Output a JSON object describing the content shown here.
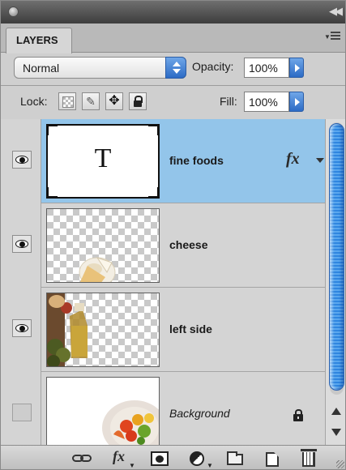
{
  "panel": {
    "tab_label": "LAYERS"
  },
  "controls": {
    "blend_mode": "Normal",
    "opacity_label": "Opacity:",
    "opacity_value": "100%",
    "lock_label": "Lock:",
    "fill_label": "Fill:",
    "fill_value": "100%"
  },
  "layers": [
    {
      "name": "fine foods",
      "visible": true,
      "selected": true,
      "thumb_glyph": "T",
      "effects": "fx"
    },
    {
      "name": "cheese",
      "visible": true,
      "selected": false
    },
    {
      "name": "left side",
      "visible": true,
      "selected": false
    },
    {
      "name": "Background",
      "visible": false,
      "selected": false,
      "locked": true
    }
  ],
  "bottom_toolbar": {
    "fx_label": "fx"
  },
  "icons": [
    "eye-icon",
    "link-layers-icon",
    "add-layer-style-icon",
    "add-mask-icon",
    "adjustment-layer-icon",
    "new-group-icon",
    "new-layer-icon",
    "delete-layer-icon",
    "lock-icon"
  ],
  "colors": {
    "selected_row": "#93c5ea",
    "scroll_thumb": "#2f86e0",
    "accent_blue": "#2c6bc5"
  }
}
